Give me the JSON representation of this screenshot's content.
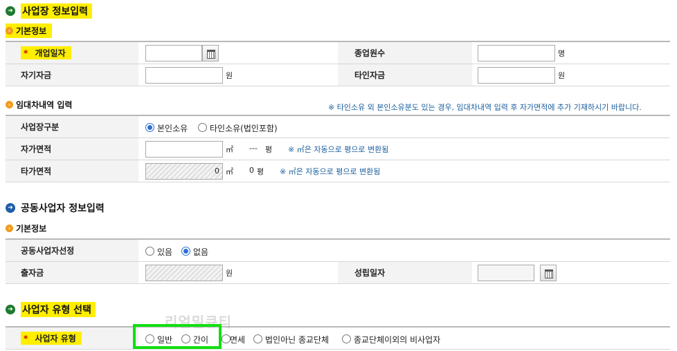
{
  "business_info": {
    "title": "사업장 정보입력",
    "basic_subtitle": "기본정보",
    "opening_date_label": "개업일자",
    "employees_label": "종업원수",
    "employees_unit": "명",
    "own_capital_label": "자기자금",
    "own_capital_unit": "원",
    "other_capital_label": "타인자금",
    "other_capital_unit": "원"
  },
  "lease": {
    "subtitle": "임대차내역 입력",
    "notice": "※ 타인소유 외 본인소유분도 있는 경우, 임대차내역 입력 후 자가면적에 추가 기재하시기 바랍니다.",
    "site_type_label": "사업장구분",
    "site_type_options": [
      "본인소유",
      "타인소유(법인포함)"
    ],
    "site_type_selected": "본인소유",
    "own_area_label": "자가면적",
    "own_area_unit": "㎡",
    "own_area_pyeong": "---",
    "pyeong_unit": "평",
    "convert_note": "※ ㎡은 자동으로 평으로 변환됨",
    "other_area_label": "타가면적",
    "other_area_value": "0",
    "other_area_unit": "㎡",
    "other_area_pyeong": "0",
    "pyeong_unit2": "평",
    "convert_note2": "※ ㎡은 자동으로 평으로 변환됨"
  },
  "joint": {
    "title": "공동사업자 정보입력",
    "basic_subtitle": "기본정보",
    "select_label": "공동사업자선정",
    "options": [
      "있음",
      "없음"
    ],
    "selected": "없음",
    "investment_label": "출자금",
    "investment_unit": "원",
    "establish_date_label": "성립일자"
  },
  "biz_type": {
    "title": "사업자 유형 선택",
    "label": "사업자 유형",
    "options": [
      "일반",
      "간이",
      "면세",
      "법인아닌 종교단체",
      "종교단체이외의 비사업자"
    ],
    "selected": null
  },
  "watermark": "리얼밀큐티",
  "colors": {
    "highlight": "#ffee00",
    "accent_blue": "#1a5e9e",
    "required_star": "#d40000",
    "selection_box": "#10e010"
  },
  "icons": [
    "green-arrow-icon",
    "orange-dot-icon",
    "blue-arrow-icon",
    "calendar-icon"
  ]
}
